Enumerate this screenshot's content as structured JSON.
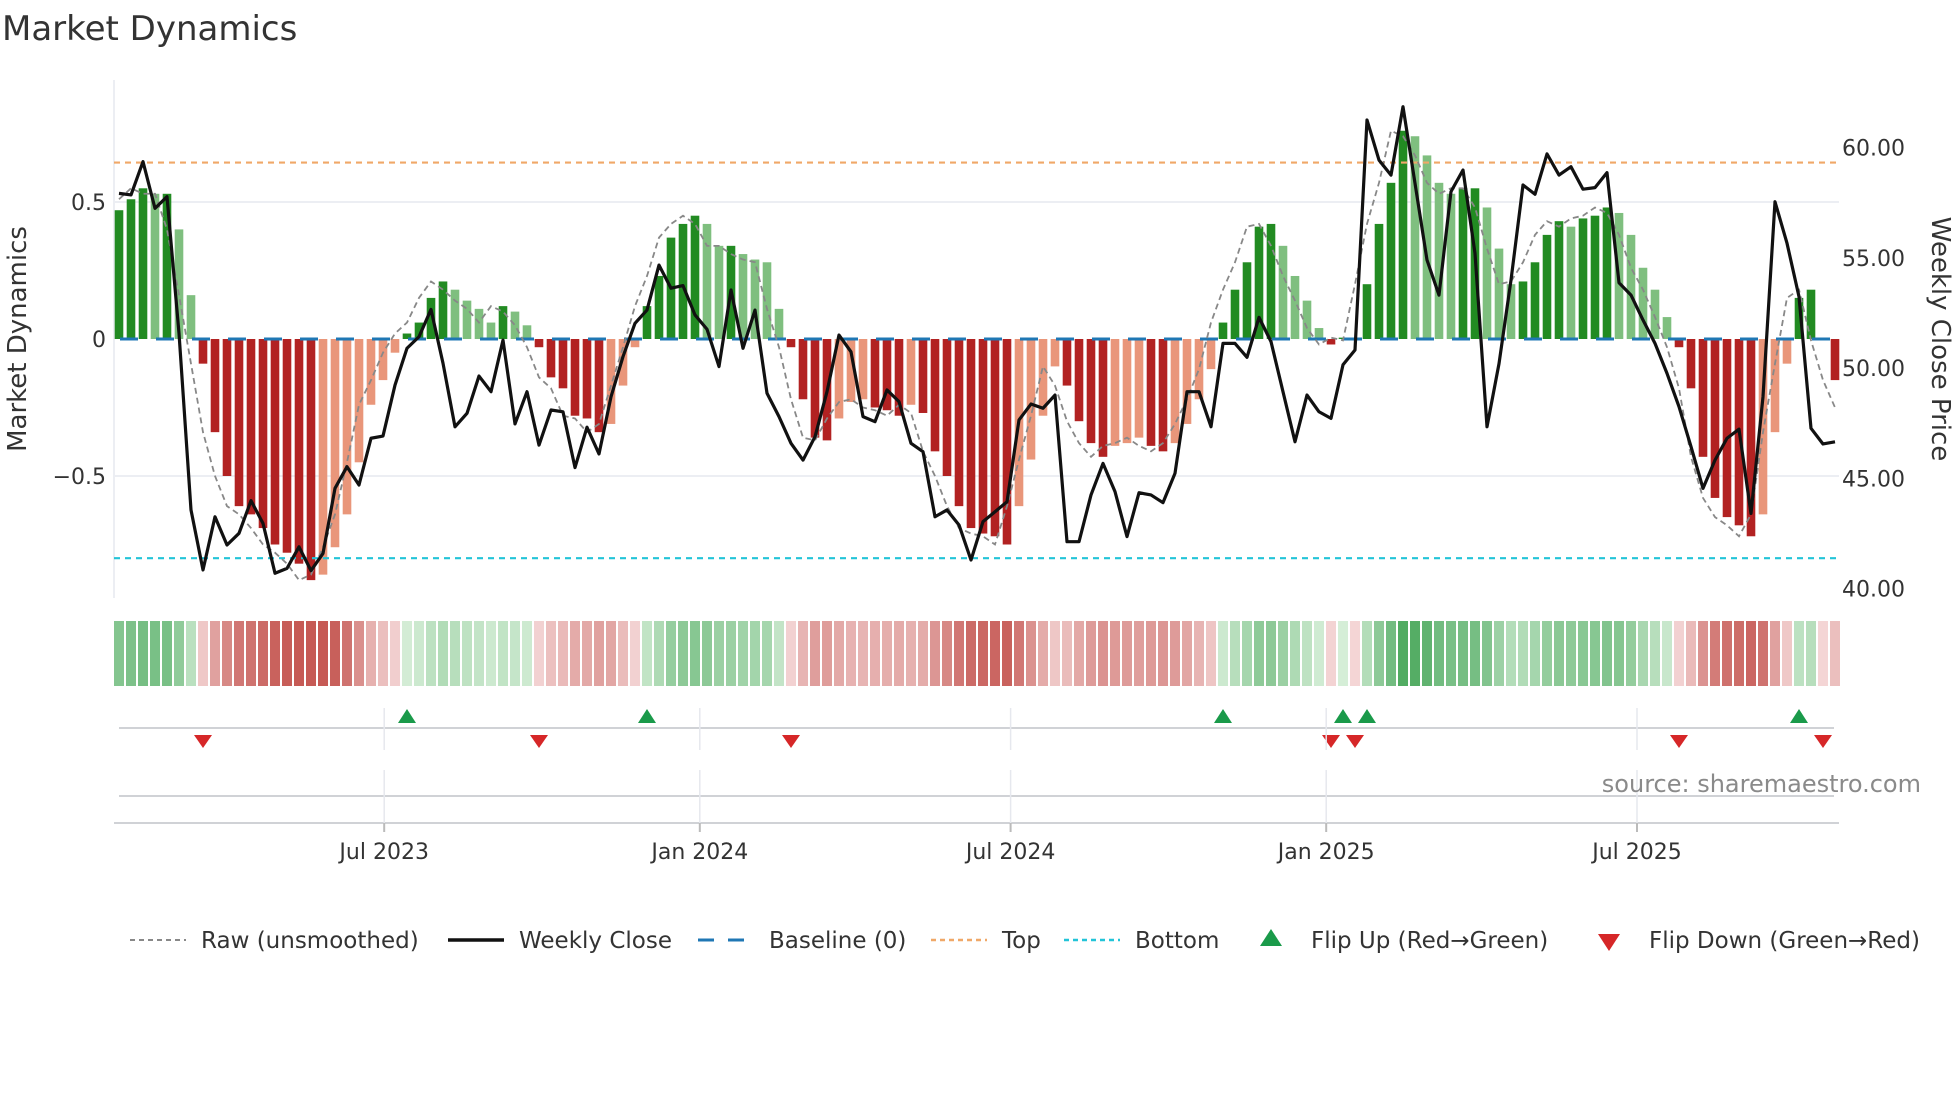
{
  "chart_data": {
    "type": "bar",
    "title": "Market Dynamics",
    "ylabel": "Market Dynamics",
    "y2label": "Weekly Close Price",
    "source": "source: sharemaestro.com",
    "ylim": [
      -0.95,
      0.95
    ],
    "y2lim": [
      40.0,
      61.6
    ],
    "yticks": [
      {
        "v": 0.5,
        "label": "0.5"
      },
      {
        "v": 0,
        "label": "0"
      },
      {
        "v": -0.5,
        "label": "−0.5"
      }
    ],
    "y2ticks": [
      {
        "v": 60,
        "label": "60.00"
      },
      {
        "v": 55,
        "label": "55.00"
      },
      {
        "v": 50,
        "label": "50.00"
      },
      {
        "v": 45,
        "label": "45.00"
      },
      {
        "v": 40,
        "label": "40.00"
      }
    ],
    "xticks": [
      {
        "week": 22.1,
        "label": "Jul 2023"
      },
      {
        "week": 48.4,
        "label": "Jan 2024"
      },
      {
        "week": 74.3,
        "label": "Jul 2024"
      },
      {
        "week": 100.6,
        "label": "Jan 2025"
      },
      {
        "week": 126.5,
        "label": "Jul 2025"
      }
    ],
    "thresholds": {
      "top": 0.644,
      "bottom": -0.8,
      "baseline": 0
    },
    "grid": true,
    "legend_position": "bottom",
    "legend": [
      {
        "key": "raw",
        "label": "Raw (unsmoothed)"
      },
      {
        "key": "close",
        "label": "Weekly Close"
      },
      {
        "key": "baseline",
        "label": "Baseline (0)"
      },
      {
        "key": "top",
        "label": "Top"
      },
      {
        "key": "bottom",
        "label": "Bottom"
      },
      {
        "key": "flipup",
        "label": "Flip Up (Red→Green)"
      },
      {
        "key": "flipdown",
        "label": "Flip Down (Green→Red)"
      }
    ],
    "colors": {
      "pos_strong": "#228b22",
      "pos_weak": "#7fbf7f",
      "neg_strong": "#b22222",
      "neg_weak": "#e9967a",
      "raw": "#888888",
      "close": "#111111",
      "baseline": "#1f77b4",
      "top": "#f0a868",
      "bottom": "#22c4d8",
      "flipup": "#1a9a4a",
      "flipdown": "#d62728"
    },
    "series": [
      {
        "name": "Market Dynamics (smoothed)",
        "values": [
          0.47,
          0.51,
          0.55,
          0.53,
          0.53,
          0.4,
          0.16,
          -0.09,
          -0.34,
          -0.5,
          -0.61,
          -0.64,
          -0.69,
          -0.75,
          -0.78,
          -0.82,
          -0.88,
          -0.86,
          -0.76,
          -0.64,
          -0.45,
          -0.24,
          -0.15,
          -0.05,
          0.02,
          0.06,
          0.15,
          0.21,
          0.18,
          0.14,
          0.11,
          0.06,
          0.12,
          0.1,
          0.05,
          -0.03,
          -0.14,
          -0.18,
          -0.28,
          -0.29,
          -0.34,
          -0.31,
          -0.17,
          -0.03,
          0.12,
          0.23,
          0.37,
          0.42,
          0.45,
          0.42,
          0.34,
          0.34,
          0.31,
          0.29,
          0.28,
          0.11,
          -0.03,
          -0.22,
          -0.36,
          -0.37,
          -0.29,
          -0.23,
          -0.22,
          -0.25,
          -0.26,
          -0.28,
          -0.24,
          -0.27,
          -0.41,
          -0.5,
          -0.61,
          -0.69,
          -0.71,
          -0.72,
          -0.75,
          -0.61,
          -0.44,
          -0.28,
          -0.1,
          -0.17,
          -0.3,
          -0.38,
          -0.43,
          -0.39,
          -0.38,
          -0.36,
          -0.39,
          -0.41,
          -0.38,
          -0.31,
          -0.22,
          -0.11,
          0.06,
          0.18,
          0.28,
          0.41,
          0.42,
          0.34,
          0.23,
          0.14,
          0.04,
          -0.02,
          0.005,
          -0.005,
          0.2,
          0.42,
          0.57,
          0.76,
          0.74,
          0.67,
          0.57,
          0.53,
          0.55,
          0.55,
          0.48,
          0.33,
          0.2,
          0.21,
          0.28,
          0.38,
          0.43,
          0.41,
          0.44,
          0.45,
          0.48,
          0.46,
          0.38,
          0.26,
          0.18,
          0.08,
          -0.03,
          -0.18,
          -0.43,
          -0.58,
          -0.65,
          -0.68,
          -0.72,
          -0.64,
          -0.34,
          -0.09,
          0.15,
          0.18,
          -0.005,
          -0.15
        ]
      },
      {
        "name": "Raw (unsmoothed)",
        "values": [
          0.51,
          0.55,
          0.53,
          0.53,
          0.4,
          0.16,
          -0.09,
          -0.34,
          -0.5,
          -0.61,
          -0.64,
          -0.69,
          -0.75,
          -0.78,
          -0.82,
          -0.88,
          -0.86,
          -0.76,
          -0.64,
          -0.45,
          -0.24,
          -0.15,
          -0.05,
          0.02,
          0.06,
          0.15,
          0.21,
          0.18,
          0.14,
          0.11,
          0.06,
          0.12,
          0.1,
          0.05,
          -0.03,
          -0.14,
          -0.18,
          -0.28,
          -0.29,
          -0.34,
          -0.31,
          -0.17,
          -0.03,
          0.12,
          0.23,
          0.37,
          0.42,
          0.45,
          0.42,
          0.34,
          0.34,
          0.31,
          0.29,
          0.28,
          0.11,
          -0.03,
          -0.22,
          -0.36,
          -0.37,
          -0.29,
          -0.23,
          -0.22,
          -0.25,
          -0.26,
          -0.28,
          -0.24,
          -0.27,
          -0.41,
          -0.5,
          -0.61,
          -0.69,
          -0.71,
          -0.72,
          -0.75,
          -0.61,
          -0.44,
          -0.28,
          -0.1,
          -0.17,
          -0.3,
          -0.38,
          -0.43,
          -0.39,
          -0.38,
          -0.36,
          -0.39,
          -0.41,
          -0.38,
          -0.31,
          -0.22,
          -0.11,
          0.06,
          0.18,
          0.28,
          0.41,
          0.42,
          0.34,
          0.23,
          0.14,
          0.04,
          -0.02,
          0.005,
          -0.005,
          0.2,
          0.42,
          0.57,
          0.76,
          0.74,
          0.67,
          0.57,
          0.53,
          0.55,
          0.55,
          0.48,
          0.33,
          0.2,
          0.21,
          0.28,
          0.38,
          0.43,
          0.41,
          0.44,
          0.45,
          0.48,
          0.46,
          0.38,
          0.26,
          0.18,
          0.08,
          -0.03,
          -0.18,
          -0.43,
          -0.58,
          -0.65,
          -0.68,
          -0.72,
          -0.64,
          -0.34,
          -0.09,
          0.15,
          0.18,
          -0.005,
          -0.15,
          -0.25
        ]
      },
      {
        "name": "Weekly Close",
        "axis": "right",
        "values": [
          57.92,
          57.85,
          59.36,
          57.24,
          57.77,
          51.58,
          43.57,
          40.85,
          43.26,
          41.98,
          42.51,
          43.99,
          42.96,
          40.7,
          40.92,
          41.9,
          40.82,
          41.6,
          44.55,
          45.53,
          44.7,
          46.82,
          46.92,
          49.23,
          50.9,
          51.42,
          52.66,
          50.22,
          47.34,
          47.95,
          49.64,
          48.93,
          51.27,
          47.47,
          48.93,
          46.51,
          48.1,
          48.02,
          45.49,
          47.32,
          46.11,
          48.7,
          50.52,
          52.03,
          52.63,
          54.67,
          53.62,
          53.74,
          52.41,
          51.76,
          50.07,
          53.54,
          50.9,
          52.63,
          48.86,
          47.8,
          46.59,
          45.83,
          46.89,
          48.93,
          51.5,
          50.74,
          47.8,
          47.57,
          49.01,
          48.48,
          46.59,
          46.21,
          43.26,
          43.57,
          42.89,
          41.3,
          43.04,
          43.49,
          43.94,
          47.65,
          48.37,
          48.18,
          48.78,
          42.13,
          42.13,
          44.25,
          45.68,
          44.4,
          42.36,
          44.35,
          44.25,
          43.9,
          45.23,
          48.93,
          48.93,
          47.34,
          51.12,
          51.12,
          50.49,
          52.3,
          51.2,
          48.93,
          46.66,
          48.78,
          48.02,
          47.72,
          50.15,
          50.82,
          61.25,
          59.43,
          58.75,
          61.85,
          58.38,
          54.9,
          53.31,
          58.0,
          58.98,
          55.2,
          47.34,
          50.2,
          53.99,
          58.3,
          57.88,
          59.71,
          58.75,
          59.13,
          58.11,
          58.18,
          58.86,
          53.87,
          53.31,
          52.18,
          51.12,
          49.76,
          48.25,
          46.44,
          44.55,
          45.83,
          46.82,
          47.23,
          43.41,
          48.7,
          57.54,
          55.66,
          53.24,
          47.27,
          46.56,
          46.66
        ]
      }
    ],
    "flips": {
      "up": [
        24,
        44,
        92,
        102,
        104,
        140
      ],
      "down": [
        7,
        35,
        56,
        101,
        103,
        130,
        142
      ]
    }
  }
}
